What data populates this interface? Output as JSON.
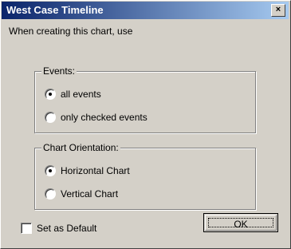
{
  "window": {
    "title": "West Case Timeline",
    "close_glyph": "×"
  },
  "dialog": {
    "intro": "When creating this chart, use",
    "events_group": {
      "legend": "Events:",
      "options": [
        "all events",
        "only checked events"
      ],
      "selected": 0
    },
    "orientation_group": {
      "legend": "Chart Orientation:",
      "options": [
        "Horizontal Chart",
        "Vertical Chart"
      ],
      "selected": 0
    },
    "default_checkbox": {
      "label": "Set as Default",
      "checked": false
    },
    "ok_label": "OK"
  }
}
